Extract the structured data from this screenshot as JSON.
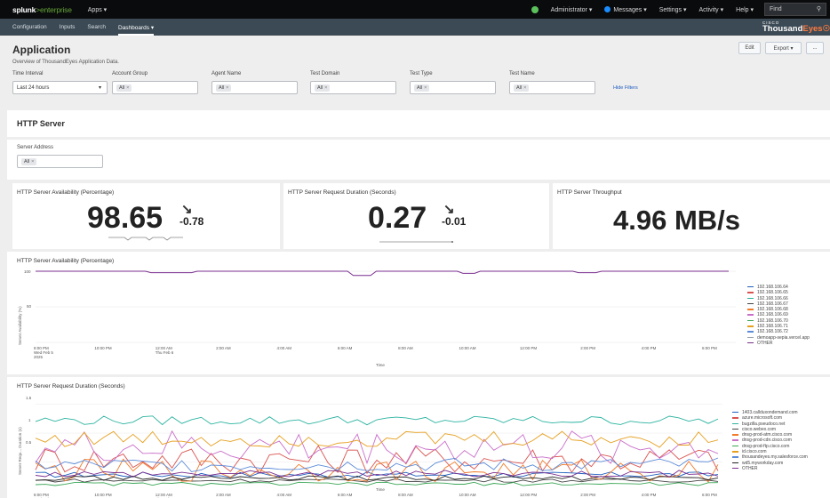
{
  "topbar": {
    "logo_main": "splunk",
    "logo_sub": ">enterprise",
    "apps": "Apps ▾",
    "administrator": "Administrator ▾",
    "messages": "Messages ▾",
    "settings": "Settings ▾",
    "activity": "Activity ▾",
    "help": "Help ▾",
    "find": "Find"
  },
  "appbar": {
    "items": [
      "Configuration",
      "Inputs",
      "Search",
      "Dashboards ▾"
    ],
    "active": "Dashboards ▾"
  },
  "brand": {
    "cisco": "CISCO",
    "name": "Thousand",
    "name2": "Eyes"
  },
  "header": {
    "title": "Application",
    "subtitle": "Overview of ThousandEyes Application Data.",
    "edit": "Edit",
    "export": "Export ▾",
    "more": "..."
  },
  "filters": [
    {
      "label": "Time Interval",
      "value": "Last 24 hours",
      "type": "select"
    },
    {
      "label": "Account Group",
      "value": "All",
      "type": "multi"
    },
    {
      "label": "Agent Name",
      "value": "All",
      "type": "multi"
    },
    {
      "label": "Test Domain",
      "value": "All",
      "type": "multi"
    },
    {
      "label": "Test Type",
      "value": "All",
      "type": "multi"
    },
    {
      "label": "Test Name",
      "value": "All",
      "type": "multi"
    }
  ],
  "hide_filters": "Hide Filters",
  "section": {
    "title": "HTTP Server"
  },
  "server_address": {
    "label": "Server Address",
    "value": "All"
  },
  "singles": [
    {
      "title": "HTTP Server Availability (Percentage)",
      "value": "98.65",
      "delta": "-0.78",
      "trend": "down"
    },
    {
      "title": "HTTP Server Request Duration (Seconds)",
      "value": "0.27",
      "delta": "-0.01",
      "trend": "down"
    },
    {
      "title": "HTTP Server Throughput",
      "value": "4.96 MB/s"
    }
  ],
  "time_ticks": [
    "8:00 PM",
    "10:00 PM",
    "12:00 AM",
    "2:00 AM",
    "4:00 AM",
    "6:00 AM",
    "8:00 AM",
    "10:00 AM",
    "12:00 PM",
    "2:00 PM",
    "4:00 PM",
    "6:00 PM"
  ],
  "tick_sub": {
    "first": [
      "Wed Feb 5",
      "2025"
    ],
    "third": [
      "Thu Feb 6"
    ]
  },
  "chart_data": [
    {
      "type": "line",
      "title": "HTTP Server Availability (Percentage)",
      "xlabel": "Time",
      "ylabel": "Server Availability (%)",
      "yticks": [
        "100",
        "50"
      ],
      "ylim": [
        0,
        100
      ],
      "x": [
        "8:00 PM",
        "10:00 PM",
        "12:00 AM",
        "2:00 AM",
        "4:00 AM",
        "6:00 AM",
        "8:00 AM",
        "10:00 AM",
        "12:00 PM",
        "2:00 PM",
        "4:00 PM",
        "6:00 PM"
      ],
      "series": [
        {
          "name": "192.168.106.64",
          "color": "#1f5fbf"
        },
        {
          "name": "192.168.106.65",
          "color": "#d9534f"
        },
        {
          "name": "192.168.106.66",
          "color": "#2bb3a0"
        },
        {
          "name": "192.168.106.67",
          "color": "#444444"
        },
        {
          "name": "192.168.106.68",
          "color": "#f07b2b"
        },
        {
          "name": "192.168.106.69",
          "color": "#c96fc9"
        },
        {
          "name": "192.168.106.70",
          "color": "#3aa655"
        },
        {
          "name": "192.168.106.71",
          "color": "#e6a020"
        },
        {
          "name": "192.168.106.72",
          "color": "#5b8bd9"
        },
        {
          "name": "demoapp-sepia.vercel.app",
          "color": "#9aa3ad"
        },
        {
          "name": "OTHER",
          "color": "#7a2f8f"
        }
      ],
      "legend": "right"
    },
    {
      "type": "line",
      "title": "HTTP Server Request Duration (Seconds)",
      "xlabel": "Time",
      "ylabel": "Server Requ... Duration (s)",
      "yticks": [
        "1.5",
        "1",
        "0.5"
      ],
      "ylim": [
        0,
        1.6
      ],
      "x": [
        "8:00 PM",
        "10:00 PM",
        "12:00 AM",
        "2:00 AM",
        "4:00 AM",
        "6:00 AM",
        "8:00 AM",
        "10:00 AM",
        "12:00 PM",
        "2:00 PM",
        "4:00 PM",
        "6:00 PM"
      ],
      "series": [
        {
          "name": "1403.callduxondemand.com",
          "color": "#1f5fbf"
        },
        {
          "name": "azure.microsoft.com",
          "color": "#d9534f"
        },
        {
          "name": "bugzilla.pseudoco.net",
          "color": "#2bb3a0"
        },
        {
          "name": "cisco.webex.com",
          "color": "#444444"
        },
        {
          "name": "dnsg-prod-atm.cisco.com",
          "color": "#f07b2b"
        },
        {
          "name": "dnsg-prod-cdn.cisco.com",
          "color": "#c96fc9"
        },
        {
          "name": "dnsg-prod-ftp.cisco.com",
          "color": "#3aa655"
        },
        {
          "name": "id.cisco.com",
          "color": "#e6a020"
        },
        {
          "name": "thousandeyes.my.salesforce.com",
          "color": "#5b8bd9"
        },
        {
          "name": "wd5.myworkday.com",
          "color": "#222222"
        },
        {
          "name": "OTHER",
          "color": "#7a2f8f"
        }
      ],
      "legend": "right"
    }
  ]
}
